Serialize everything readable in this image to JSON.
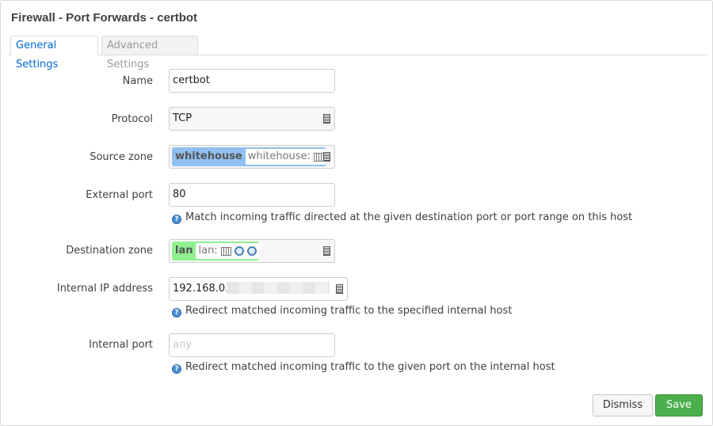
{
  "dialog": {
    "title": "Firewall - Port Forwards - certbot"
  },
  "tabs": [
    {
      "label": "General Settings",
      "active": true
    },
    {
      "label": "Advanced Settings",
      "active": false
    }
  ],
  "form": {
    "name": {
      "label": "Name",
      "value": "certbot"
    },
    "protocol": {
      "label": "Protocol",
      "value": "TCP"
    },
    "source_zone": {
      "label": "Source zone",
      "zone": "whitehouse",
      "zone_detail": "whitehouse:",
      "color": "#90c0f0"
    },
    "external_port": {
      "label": "External port",
      "value": "80",
      "hint": "Match incoming traffic directed at the given destination port or port range on this host"
    },
    "destination_zone": {
      "label": "Destination zone",
      "zone": "lan",
      "zone_detail": "lan:",
      "color": "#90f090"
    },
    "internal_ip": {
      "label": "Internal IP address",
      "value": "192.168.0.2",
      "hint": "Redirect matched incoming traffic to the specified internal host"
    },
    "internal_port": {
      "label": "Internal port",
      "placeholder": "any",
      "hint": "Redirect matched incoming traffic to the given port on the internal host"
    }
  },
  "buttons": {
    "dismiss": "Dismiss",
    "save": "Save"
  },
  "colors": {
    "accent": "#0069d6",
    "save": "#4cae4c"
  }
}
